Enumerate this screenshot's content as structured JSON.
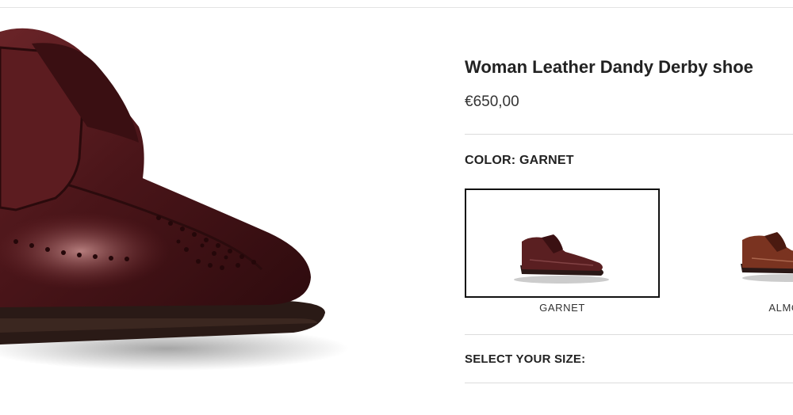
{
  "product": {
    "title": "Woman Leather Dandy Derby shoe",
    "price": "€650,00"
  },
  "color": {
    "heading_prefix": "COLOR: ",
    "selected": "GARNET",
    "options": [
      {
        "label": "GARNET",
        "hex": "#5a1f21"
      },
      {
        "label": "ALMOND",
        "hex": "#7a3320"
      }
    ]
  },
  "size": {
    "heading": "SELECT YOUR SIZE:"
  },
  "icons": {
    "hero": "shoe-product-image",
    "swatch": "shoe-thumbnail"
  }
}
